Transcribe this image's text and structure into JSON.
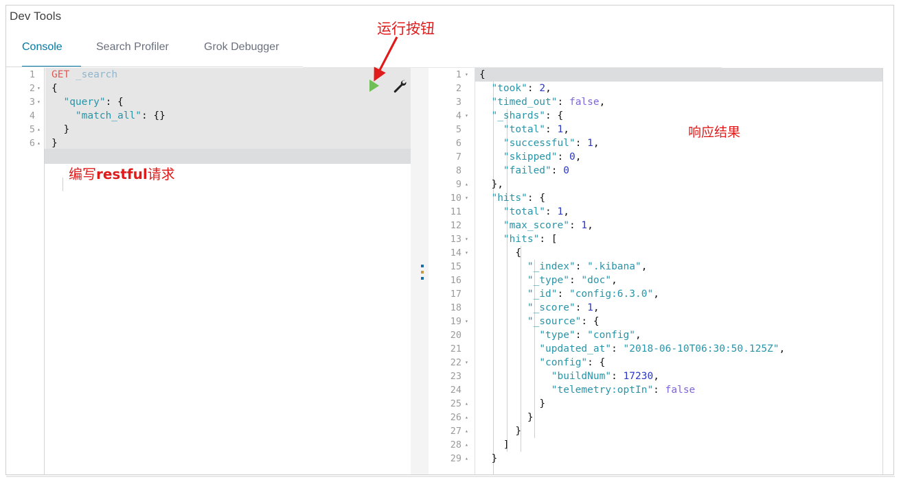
{
  "app": {
    "title": "Dev Tools"
  },
  "tabs": [
    {
      "id": "console",
      "label": "Console",
      "active": true
    },
    {
      "id": "profiler",
      "label": "Search Profiler",
      "active": false
    },
    {
      "id": "grok",
      "label": "Grok Debugger",
      "active": false
    }
  ],
  "toolbar": {
    "run_icon": "play-triangle-icon",
    "wrench_icon": "wrench-icon"
  },
  "annotations": {
    "run_button": "运行按钮",
    "request_prefix": "编写",
    "request_bold": "restful",
    "request_suffix": "请求",
    "response": "响应结果",
    "color": "#e01b1b"
  },
  "request_editor": {
    "active_line": 6,
    "lines": [
      {
        "n": "1",
        "fold": "",
        "tokens": [
          {
            "c": "t-method",
            "t": "GET"
          },
          {
            "c": "t-plain",
            "t": " "
          },
          {
            "c": "t-url",
            "t": "_search"
          }
        ]
      },
      {
        "n": "2",
        "fold": "▾",
        "tokens": [
          {
            "c": "t-punct",
            "t": "{"
          }
        ]
      },
      {
        "n": "3",
        "fold": "▾",
        "tokens": [
          {
            "c": "t-plain",
            "t": "  "
          },
          {
            "c": "t-key",
            "t": "\"query\""
          },
          {
            "c": "t-punct",
            "t": ": {"
          }
        ]
      },
      {
        "n": "4",
        "fold": "",
        "tokens": [
          {
            "c": "t-plain",
            "t": "    "
          },
          {
            "c": "t-key",
            "t": "\"match_all\""
          },
          {
            "c": "t-punct",
            "t": ": {}"
          }
        ]
      },
      {
        "n": "5",
        "fold": "▴",
        "tokens": [
          {
            "c": "t-plain",
            "t": "  "
          },
          {
            "c": "t-punct",
            "t": "}"
          }
        ]
      },
      {
        "n": "6",
        "fold": "▴",
        "tokens": [
          {
            "c": "t-punct",
            "t": "}"
          }
        ]
      }
    ]
  },
  "response_editor": {
    "active_line": 1,
    "lines": [
      {
        "n": "1",
        "fold": "▾",
        "tokens": [
          {
            "c": "t-punct",
            "t": "{"
          }
        ]
      },
      {
        "n": "2",
        "fold": "",
        "tokens": [
          {
            "c": "t-plain",
            "t": "  "
          },
          {
            "c": "t-key",
            "t": "\"took\""
          },
          {
            "c": "t-punct",
            "t": ": "
          },
          {
            "c": "t-num",
            "t": "2"
          },
          {
            "c": "t-punct",
            "t": ","
          }
        ]
      },
      {
        "n": "3",
        "fold": "",
        "tokens": [
          {
            "c": "t-plain",
            "t": "  "
          },
          {
            "c": "t-key",
            "t": "\"timed_out\""
          },
          {
            "c": "t-punct",
            "t": ": "
          },
          {
            "c": "t-bool",
            "t": "false"
          },
          {
            "c": "t-punct",
            "t": ","
          }
        ]
      },
      {
        "n": "4",
        "fold": "▾",
        "tokens": [
          {
            "c": "t-plain",
            "t": "  "
          },
          {
            "c": "t-key",
            "t": "\"_shards\""
          },
          {
            "c": "t-punct",
            "t": ": {"
          }
        ]
      },
      {
        "n": "5",
        "fold": "",
        "tokens": [
          {
            "c": "t-plain",
            "t": "    "
          },
          {
            "c": "t-key",
            "t": "\"total\""
          },
          {
            "c": "t-punct",
            "t": ": "
          },
          {
            "c": "t-num",
            "t": "1"
          },
          {
            "c": "t-punct",
            "t": ","
          }
        ]
      },
      {
        "n": "6",
        "fold": "",
        "tokens": [
          {
            "c": "t-plain",
            "t": "    "
          },
          {
            "c": "t-key",
            "t": "\"successful\""
          },
          {
            "c": "t-punct",
            "t": ": "
          },
          {
            "c": "t-num",
            "t": "1"
          },
          {
            "c": "t-punct",
            "t": ","
          }
        ]
      },
      {
        "n": "7",
        "fold": "",
        "tokens": [
          {
            "c": "t-plain",
            "t": "    "
          },
          {
            "c": "t-key",
            "t": "\"skipped\""
          },
          {
            "c": "t-punct",
            "t": ": "
          },
          {
            "c": "t-num",
            "t": "0"
          },
          {
            "c": "t-punct",
            "t": ","
          }
        ]
      },
      {
        "n": "8",
        "fold": "",
        "tokens": [
          {
            "c": "t-plain",
            "t": "    "
          },
          {
            "c": "t-key",
            "t": "\"failed\""
          },
          {
            "c": "t-punct",
            "t": ": "
          },
          {
            "c": "t-num",
            "t": "0"
          }
        ]
      },
      {
        "n": "9",
        "fold": "▴",
        "tokens": [
          {
            "c": "t-plain",
            "t": "  "
          },
          {
            "c": "t-punct",
            "t": "},"
          }
        ]
      },
      {
        "n": "10",
        "fold": "▾",
        "tokens": [
          {
            "c": "t-plain",
            "t": "  "
          },
          {
            "c": "t-key",
            "t": "\"hits\""
          },
          {
            "c": "t-punct",
            "t": ": {"
          }
        ]
      },
      {
        "n": "11",
        "fold": "",
        "tokens": [
          {
            "c": "t-plain",
            "t": "    "
          },
          {
            "c": "t-key",
            "t": "\"total\""
          },
          {
            "c": "t-punct",
            "t": ": "
          },
          {
            "c": "t-num",
            "t": "1"
          },
          {
            "c": "t-punct",
            "t": ","
          }
        ]
      },
      {
        "n": "12",
        "fold": "",
        "tokens": [
          {
            "c": "t-plain",
            "t": "    "
          },
          {
            "c": "t-key",
            "t": "\"max_score\""
          },
          {
            "c": "t-punct",
            "t": ": "
          },
          {
            "c": "t-num",
            "t": "1"
          },
          {
            "c": "t-punct",
            "t": ","
          }
        ]
      },
      {
        "n": "13",
        "fold": "▾",
        "tokens": [
          {
            "c": "t-plain",
            "t": "    "
          },
          {
            "c": "t-key",
            "t": "\"hits\""
          },
          {
            "c": "t-punct",
            "t": ": ["
          }
        ]
      },
      {
        "n": "14",
        "fold": "▾",
        "tokens": [
          {
            "c": "t-plain",
            "t": "      "
          },
          {
            "c": "t-punct",
            "t": "{"
          }
        ]
      },
      {
        "n": "15",
        "fold": "",
        "tokens": [
          {
            "c": "t-plain",
            "t": "        "
          },
          {
            "c": "t-key",
            "t": "\"_index\""
          },
          {
            "c": "t-punct",
            "t": ": "
          },
          {
            "c": "t-str",
            "t": "\".kibana\""
          },
          {
            "c": "t-punct",
            "t": ","
          }
        ]
      },
      {
        "n": "16",
        "fold": "",
        "tokens": [
          {
            "c": "t-plain",
            "t": "        "
          },
          {
            "c": "t-key",
            "t": "\"_type\""
          },
          {
            "c": "t-punct",
            "t": ": "
          },
          {
            "c": "t-str",
            "t": "\"doc\""
          },
          {
            "c": "t-punct",
            "t": ","
          }
        ]
      },
      {
        "n": "17",
        "fold": "",
        "tokens": [
          {
            "c": "t-plain",
            "t": "        "
          },
          {
            "c": "t-key",
            "t": "\"_id\""
          },
          {
            "c": "t-punct",
            "t": ": "
          },
          {
            "c": "t-str",
            "t": "\"config:6.3.0\""
          },
          {
            "c": "t-punct",
            "t": ","
          }
        ]
      },
      {
        "n": "18",
        "fold": "",
        "tokens": [
          {
            "c": "t-plain",
            "t": "        "
          },
          {
            "c": "t-key",
            "t": "\"_score\""
          },
          {
            "c": "t-punct",
            "t": ": "
          },
          {
            "c": "t-num",
            "t": "1"
          },
          {
            "c": "t-punct",
            "t": ","
          }
        ]
      },
      {
        "n": "19",
        "fold": "▾",
        "tokens": [
          {
            "c": "t-plain",
            "t": "        "
          },
          {
            "c": "t-key",
            "t": "\"_source\""
          },
          {
            "c": "t-punct",
            "t": ": {"
          }
        ]
      },
      {
        "n": "20",
        "fold": "",
        "tokens": [
          {
            "c": "t-plain",
            "t": "          "
          },
          {
            "c": "t-key",
            "t": "\"type\""
          },
          {
            "c": "t-punct",
            "t": ": "
          },
          {
            "c": "t-str",
            "t": "\"config\""
          },
          {
            "c": "t-punct",
            "t": ","
          }
        ]
      },
      {
        "n": "21",
        "fold": "",
        "tokens": [
          {
            "c": "t-plain",
            "t": "          "
          },
          {
            "c": "t-key",
            "t": "\"updated_at\""
          },
          {
            "c": "t-punct",
            "t": ": "
          },
          {
            "c": "t-str",
            "t": "\"2018-06-10T06:30:50.125Z\""
          },
          {
            "c": "t-punct",
            "t": ","
          }
        ]
      },
      {
        "n": "22",
        "fold": "▾",
        "tokens": [
          {
            "c": "t-plain",
            "t": "          "
          },
          {
            "c": "t-key",
            "t": "\"config\""
          },
          {
            "c": "t-punct",
            "t": ": {"
          }
        ]
      },
      {
        "n": "23",
        "fold": "",
        "tokens": [
          {
            "c": "t-plain",
            "t": "            "
          },
          {
            "c": "t-key",
            "t": "\"buildNum\""
          },
          {
            "c": "t-punct",
            "t": ": "
          },
          {
            "c": "t-num",
            "t": "17230"
          },
          {
            "c": "t-punct",
            "t": ","
          }
        ]
      },
      {
        "n": "24",
        "fold": "",
        "tokens": [
          {
            "c": "t-plain",
            "t": "            "
          },
          {
            "c": "t-key",
            "t": "\"telemetry:optIn\""
          },
          {
            "c": "t-punct",
            "t": ": "
          },
          {
            "c": "t-bool",
            "t": "false"
          }
        ]
      },
      {
        "n": "25",
        "fold": "▴",
        "tokens": [
          {
            "c": "t-plain",
            "t": "          "
          },
          {
            "c": "t-punct",
            "t": "}"
          }
        ]
      },
      {
        "n": "26",
        "fold": "▴",
        "tokens": [
          {
            "c": "t-plain",
            "t": "        "
          },
          {
            "c": "t-punct",
            "t": "}"
          }
        ]
      },
      {
        "n": "27",
        "fold": "▴",
        "tokens": [
          {
            "c": "t-plain",
            "t": "      "
          },
          {
            "c": "t-punct",
            "t": "}"
          }
        ]
      },
      {
        "n": "28",
        "fold": "▴",
        "tokens": [
          {
            "c": "t-plain",
            "t": "    "
          },
          {
            "c": "t-punct",
            "t": "]"
          }
        ]
      },
      {
        "n": "29",
        "fold": "▴",
        "tokens": [
          {
            "c": "t-plain",
            "t": "  "
          },
          {
            "c": "t-punct",
            "t": "}"
          }
        ]
      }
    ]
  }
}
